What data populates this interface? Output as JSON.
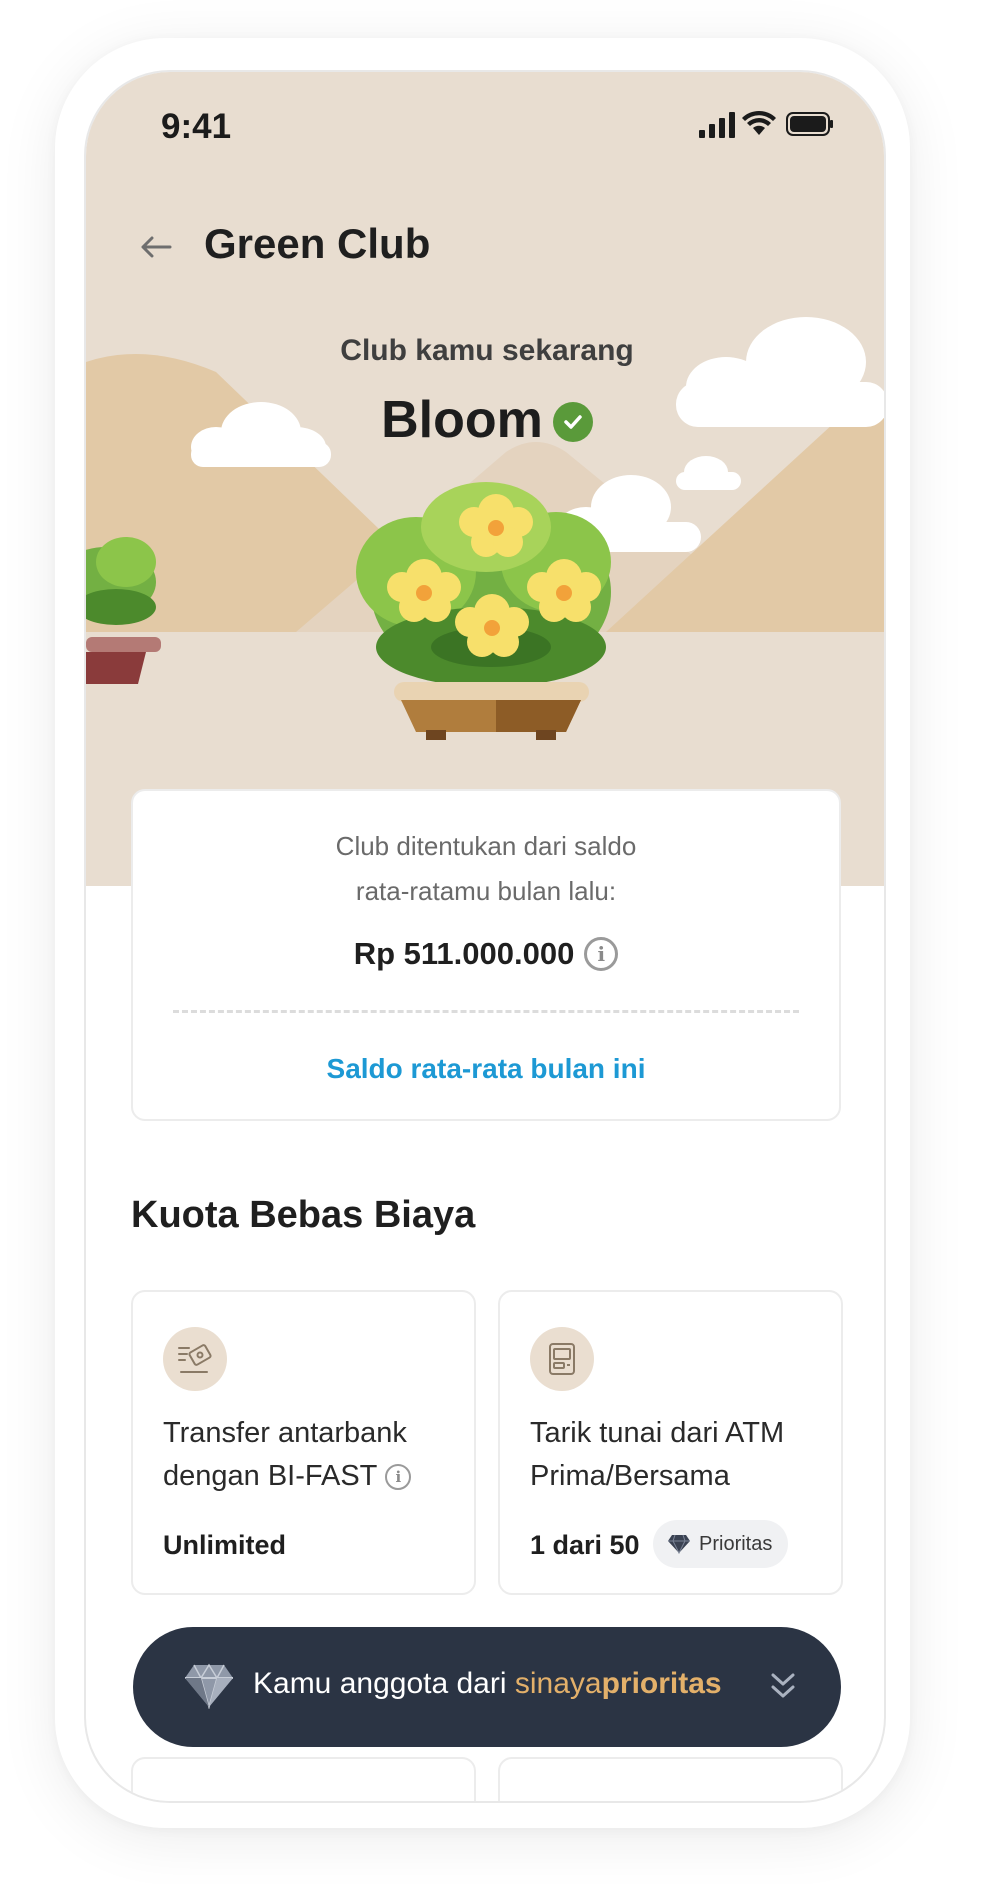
{
  "status_bar": {
    "time": "9:41"
  },
  "header": {
    "title": "Green Club",
    "back_icon": "arrow-left-icon"
  },
  "club": {
    "label": "Club kamu sekarang",
    "name": "Bloom"
  },
  "info_card": {
    "line1": "Club ditentukan dari saldo",
    "line2": "rata-ratamu bulan lalu:",
    "amount": "Rp 511.000.000",
    "link": "Saldo rata-rata bulan ini"
  },
  "quota": {
    "title": "Kuota Bebas Biaya",
    "cards": [
      {
        "line1": "Transfer antarbank",
        "line2": "dengan BI-FAST",
        "value": "Unlimited",
        "icon": "transfer-icon"
      },
      {
        "line1": "Tarik tunai dari ATM",
        "line2": "Prima/Bersama",
        "value": "1 dari 50",
        "badge": "Prioritas",
        "icon": "atm-icon"
      }
    ]
  },
  "priority_banner": {
    "text": "Kamu anggota dari",
    "brand_part1": "sinaya",
    "brand_part2": "prioritas"
  },
  "colors": {
    "hero_bg": "#e8ddd0",
    "link_blue": "#1d99d4",
    "banner_bg": "#2b3444",
    "brand_gold": "#e3b06a",
    "verified_green": "#5a9a3a"
  }
}
